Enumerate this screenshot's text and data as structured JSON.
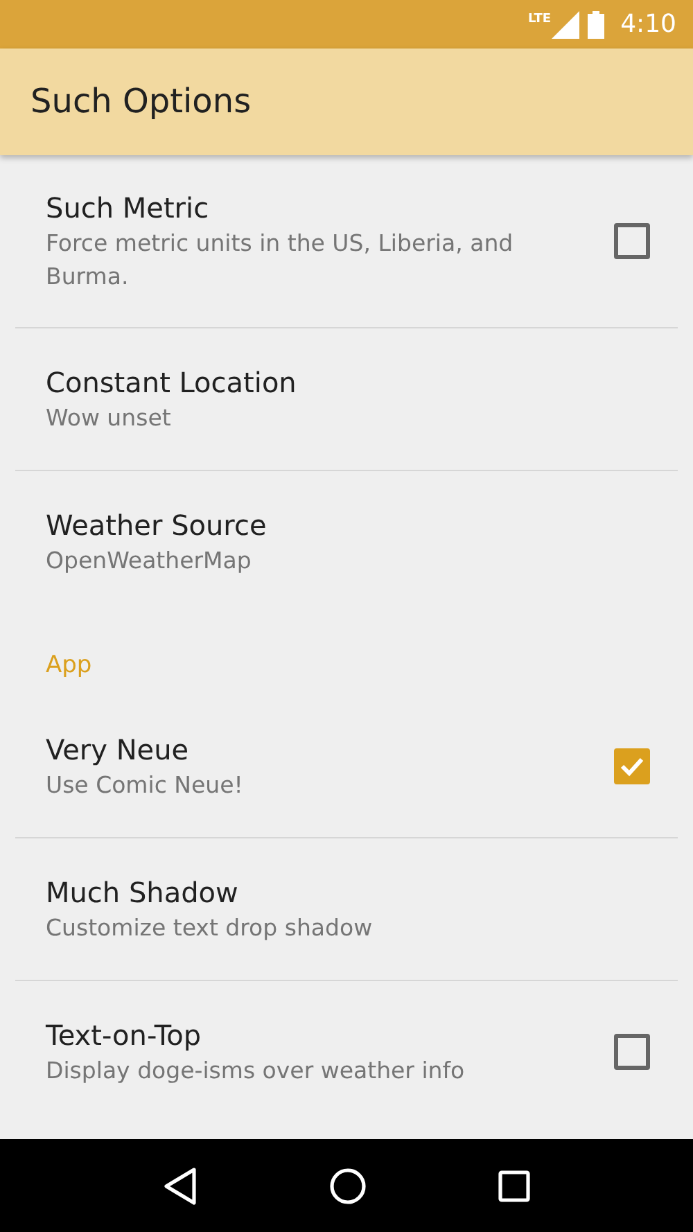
{
  "status_bar": {
    "network": "LTE",
    "time": "4:10"
  },
  "app_bar": {
    "title": "Such Options"
  },
  "preferences": [
    {
      "kind": "checkbox",
      "title": "Such Metric",
      "summary": "Force metric units in the US, Liberia, and Burma.",
      "checked": false
    },
    {
      "kind": "plain",
      "title": "Constant Location",
      "summary": "Wow unset"
    },
    {
      "kind": "plain",
      "title": "Weather Source",
      "summary": "OpenWeatherMap"
    },
    {
      "kind": "category",
      "title": "App"
    },
    {
      "kind": "checkbox",
      "title": "Very Neue",
      "summary": "Use Comic Neue!",
      "checked": true
    },
    {
      "kind": "plain",
      "title": "Much Shadow",
      "summary": "Customize text drop shadow"
    },
    {
      "kind": "checkbox",
      "title": "Text-on-Top",
      "summary": "Display doge-isms over weather info",
      "checked": false
    }
  ]
}
